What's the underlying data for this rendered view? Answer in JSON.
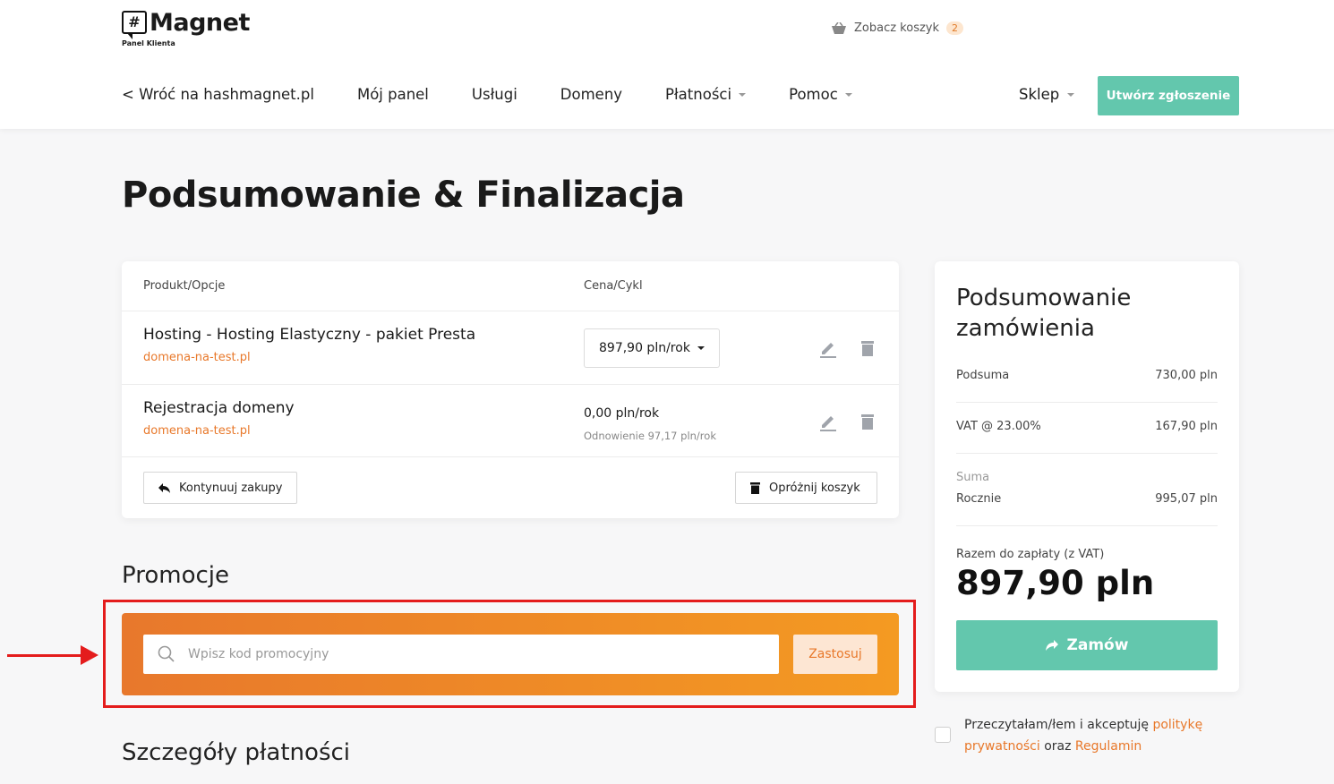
{
  "header": {
    "logo_text": "Magnet",
    "logo_mark": "#",
    "logo_sub": "Panel Klienta",
    "cart_label": "Zobacz koszyk",
    "cart_count": "2",
    "nav": {
      "back": "< Wróć na hashmagnet.pl",
      "panel": "Mój panel",
      "services": "Usługi",
      "domains": "Domeny",
      "payments": "Płatności",
      "help": "Pomoc",
      "shop": "Sklep"
    },
    "create_ticket": "Utwórz zgłoszenie"
  },
  "page_title": "Podsumowanie & Finalizacja",
  "cart": {
    "col_product": "Produkt/Opcje",
    "col_price": "Cena/Cykl",
    "items": [
      {
        "name": "Hosting - Hosting Elastyczny - pakiet Presta",
        "domain": "domena-na-test.pl",
        "price": "897,90 pln/rok"
      },
      {
        "name": "Rejestracja domeny",
        "domain": "domena-na-test.pl",
        "price": "0,00 pln/rok",
        "renewal": "Odnowienie 97,17 pln/rok"
      }
    ],
    "continue_label": "Kontynuuj zakupy",
    "empty_label": "Opróżnij koszyk"
  },
  "promo": {
    "title": "Promocje",
    "placeholder": "Wpisz kod promocyjny",
    "apply_label": "Zastosuj"
  },
  "payment_details_title": "Szczegóły płatności",
  "summary": {
    "title": "Podsumowanie zamówienia",
    "subtotal_label": "Podsuma",
    "subtotal_value": "730,00 pln",
    "vat_label": "VAT @ 23.00%",
    "vat_value": "167,90 pln",
    "sum_label": "Suma",
    "yearly_label": "Rocznie",
    "yearly_value": "995,07 pln",
    "total_label": "Razem do zapłaty (z VAT)",
    "total_value": "897,90 pln",
    "order_label": "Zamów"
  },
  "terms": {
    "text_before": "Przeczytałam/łem i akceptuję ",
    "privacy_link": "politykę prywatności",
    "text_mid": " oraz ",
    "rules_link": "Regulamin"
  },
  "colors": {
    "accent_green": "#63c7ad",
    "accent_orange": "#e8782a",
    "highlight_red": "#e41c1c"
  }
}
